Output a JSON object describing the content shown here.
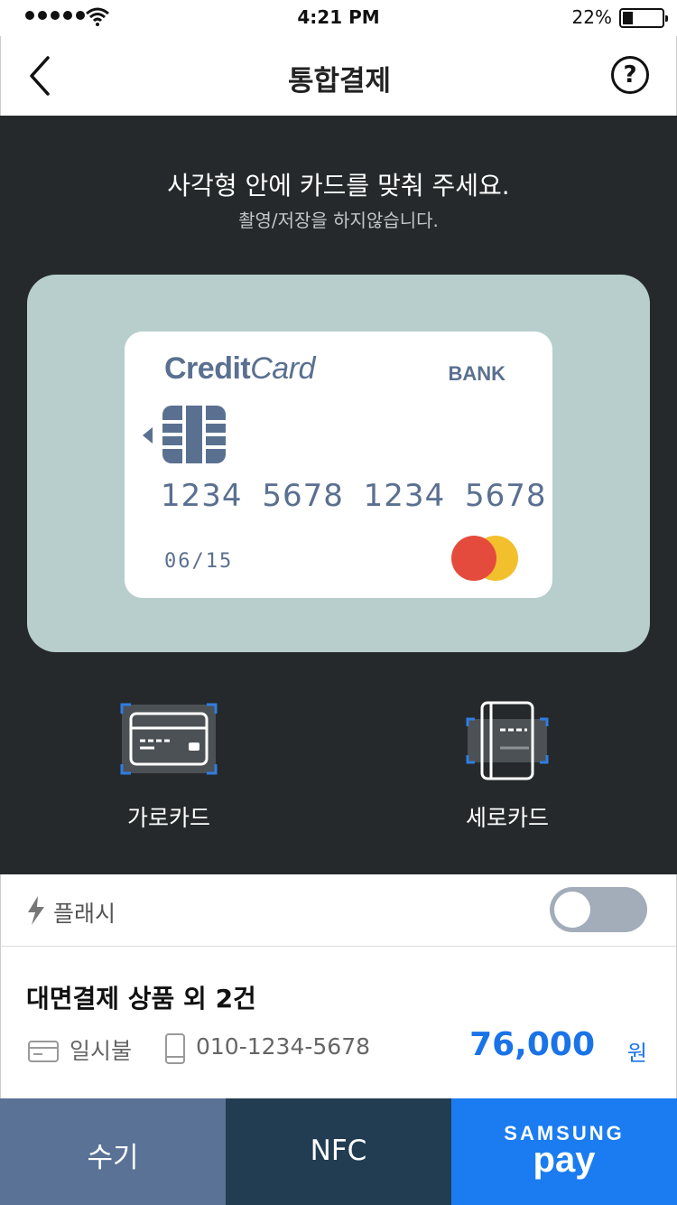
{
  "status_bar": {
    "time": "4:21 PM",
    "battery": "22%"
  },
  "header": {
    "title": "통합결제",
    "help_label": "?"
  },
  "scanner": {
    "guide_title": "사각형 안에 카드를 맞춰 주세요.",
    "guide_subtitle": "촬영/저장을 하지않습니다.",
    "card": {
      "brand_bold": "Credit",
      "brand_italic": "Card",
      "bank": "BANK",
      "number": "1234 5678 1234 5678",
      "expiry": "06/15"
    },
    "orientations": [
      {
        "label": "가로카드",
        "icon": "horizontal-card-icon"
      },
      {
        "label": "세로카드",
        "icon": "vertical-card-icon"
      }
    ]
  },
  "flash": {
    "label": "플래시",
    "enabled": false
  },
  "order": {
    "title": "대면결제 상품 외 2건",
    "installment": "일시불",
    "phone": "010-1234-5678",
    "amount": "76,000",
    "currency": "원"
  },
  "buttons": {
    "manual": "수기",
    "nfc": "NFC",
    "samsung": "SAMSUNG",
    "pay": "pay"
  },
  "colors": {
    "accent": "#1a73e8",
    "scanner_bg": "#25292b",
    "frame_bg": "#b8cecd",
    "manual_btn": "#5a7295",
    "nfc_btn": "#223d52",
    "pay_btn": "#1a7cf0"
  }
}
